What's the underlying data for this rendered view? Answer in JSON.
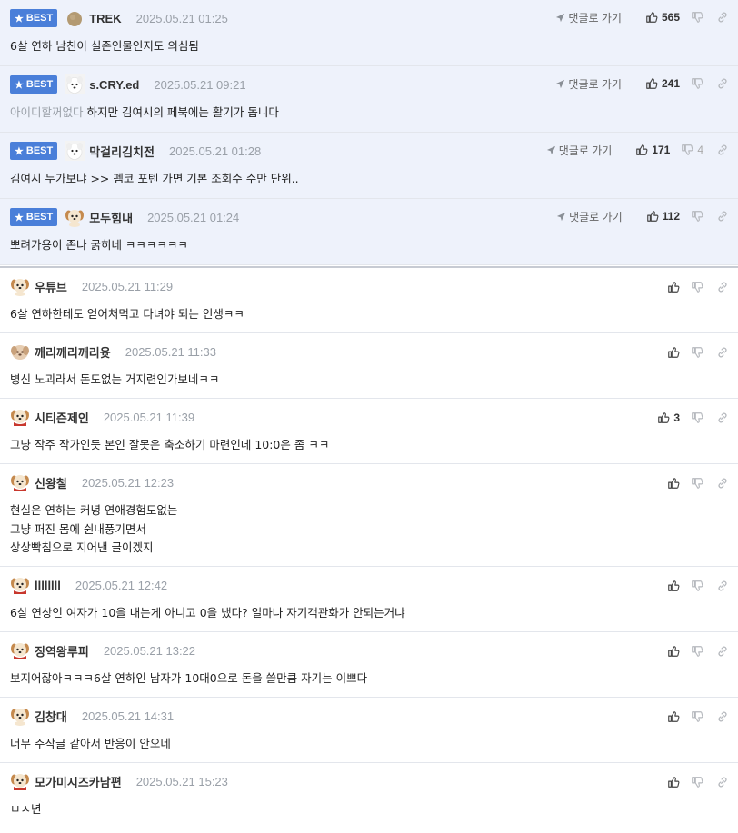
{
  "best_badge": "BEST",
  "goto_label": "댓글로 가기",
  "best_comments": [
    {
      "nick": "TREK",
      "date": "2025.05.21 01:25",
      "content": "6살 연하 남친이 실존인물인지도 의심됨",
      "up": "565",
      "down": "",
      "avatar": "brown-circle-avatar"
    },
    {
      "nick": "s.CRY.ed",
      "date": "2025.05.21 09:21",
      "muted": "아이디할꺼없다",
      "content": " 하지만 김여시의 페북에는 활기가 돕니다",
      "up": "241",
      "down": "",
      "avatar": "white-dog-avatar"
    },
    {
      "nick": "막걸리김치전",
      "date": "2025.05.21 01:28",
      "content": "김여시 누가보냐 >> 펨코 포텐 가면 기본 조회수 수만 단위..",
      "up": "171",
      "down": "4",
      "avatar": "white-dog-avatar"
    },
    {
      "nick": "모두힘내",
      "date": "2025.05.21 01:24",
      "content": "뽀려가용이 존나 굵히네 ㅋㅋㅋㅋㅋㅋ",
      "up": "112",
      "down": "",
      "avatar": "puppy-avatar"
    }
  ],
  "comments": [
    {
      "nick": "우튜브",
      "date": "2025.05.21 11:29",
      "lines": [
        "6살 연하한테도 얻어처먹고 다녀야 되는 인생ㅋㅋ"
      ],
      "up": "",
      "avatar": "puppy-avatar"
    },
    {
      "nick": "깨리깨리깨리윳",
      "date": "2025.05.21 11:33",
      "lines": [
        "병신 노괴라서 돈도없는 거지련인가보네ㅋㅋ"
      ],
      "up": "",
      "avatar": "blurred-dog-avatar"
    },
    {
      "nick": "시티즌제인",
      "date": "2025.05.21 11:39",
      "lines": [
        "그냥 작주 작가인듯 본인 잘못은 축소하기 마련인데 10:0은 좀 ㅋㅋ"
      ],
      "up": "3",
      "avatar": "puppy-scarf-avatar"
    },
    {
      "nick": "신왕철",
      "date": "2025.05.21 12:23",
      "lines": [
        "현실은 연하는 커녕 연애경험도없는",
        "그냥 퍼진 몸에 쉰내풍기면서",
        "상상빡침으로 지어낸 글이겠지"
      ],
      "up": "",
      "avatar": "puppy-scarf-avatar"
    },
    {
      "nick": "llllllll",
      "date": "2025.05.21 12:42",
      "lines": [
        "6살 연상인 여자가 10을 내는게 아니고 0을 냈다? 얼마나 자기객관화가 안되는거냐"
      ],
      "up": "",
      "avatar": "puppy-scarf-avatar"
    },
    {
      "nick": "징역왕루피",
      "date": "2025.05.21 13:22",
      "lines": [
        "보지어잖아ㅋㅋㅋ6살 연하인 남자가 10대0으로 돈을 쓸만큼 자기는 이쁘다"
      ],
      "up": "",
      "avatar": "puppy-scarf-avatar"
    },
    {
      "nick": "김창대",
      "date": "2025.05.21 14:31",
      "lines": [
        "너무 주작글 같아서 반응이 안오네"
      ],
      "up": "",
      "avatar": "puppy-avatar"
    },
    {
      "nick": "모가미시즈카남편",
      "date": "2025.05.21 15:23",
      "lines": [
        "ㅂㅅ년"
      ],
      "up": "",
      "avatar": "puppy-scarf-avatar"
    }
  ],
  "colors": {
    "best_badge": "#4a7fd9",
    "best_bg": "#eef2fb",
    "date": "#9aa0a8",
    "muted": "#9aa0a8"
  }
}
